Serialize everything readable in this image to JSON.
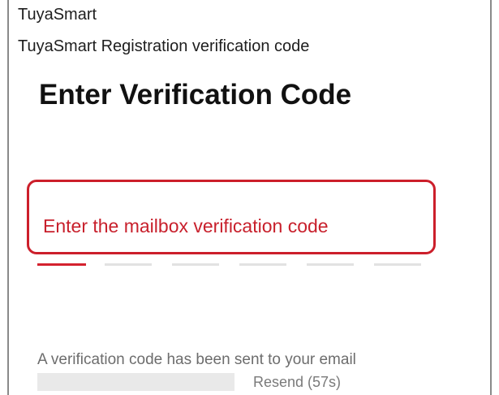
{
  "notification": {
    "app_name": "TuyaSmart",
    "message": "TuyaSmart Registration verification code"
  },
  "page": {
    "title": "Enter Verification Code",
    "instruction": "Enter the mailbox verification code"
  },
  "code_input": {
    "slot_count": 6,
    "active_slot": 1
  },
  "footer": {
    "sent_message": "A verification code has been sent to your email",
    "resend_label": "Resend (57s)"
  },
  "colors": {
    "accent": "#cc1f2b",
    "title_text": "#111111",
    "muted_text": "#6d6d6d",
    "inactive_slot": "#e2e2e2"
  }
}
